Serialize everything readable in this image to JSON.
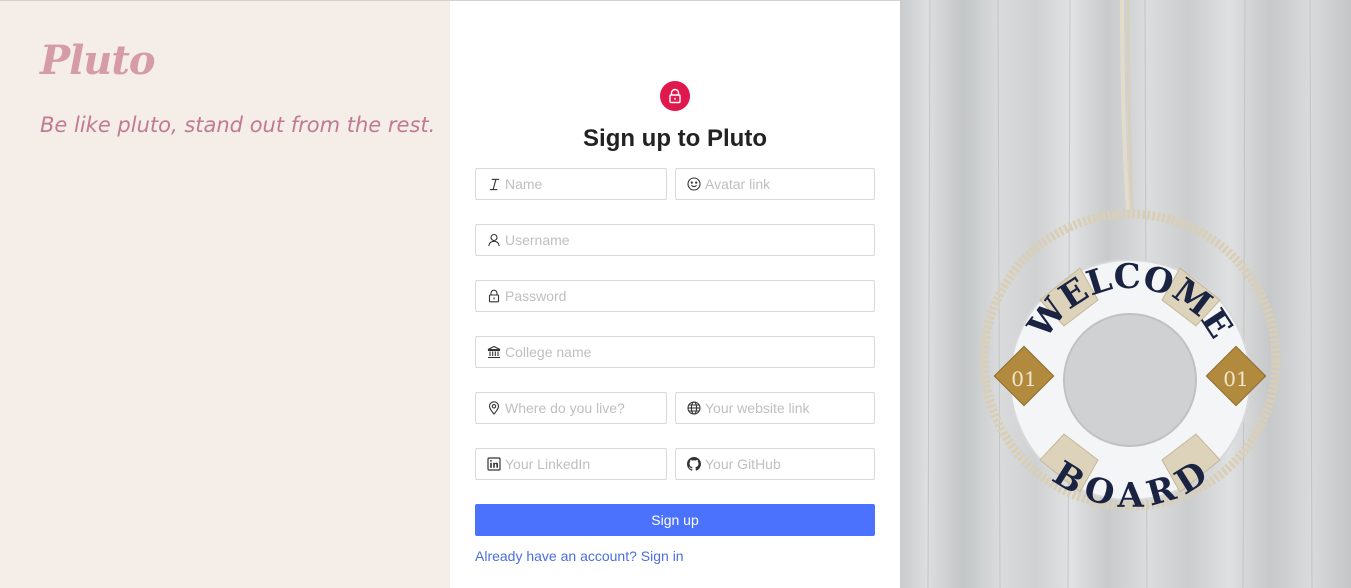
{
  "brand": {
    "name": "Pluto",
    "tagline": "Be like pluto, stand out from the rest."
  },
  "form": {
    "title": "Sign up to Pluto",
    "fields": {
      "name": {
        "placeholder": "Name",
        "icon": "text-cursor-icon"
      },
      "avatar": {
        "placeholder": "Avatar link",
        "icon": "smile-icon"
      },
      "username": {
        "placeholder": "Username",
        "icon": "user-icon"
      },
      "password": {
        "placeholder": "Password",
        "icon": "lock-icon"
      },
      "college": {
        "placeholder": "College name",
        "icon": "bank-icon"
      },
      "location": {
        "placeholder": "Where do you live?",
        "icon": "location-pin-icon"
      },
      "website": {
        "placeholder": "Your website link",
        "icon": "globe-icon"
      },
      "linkedin": {
        "placeholder": "Your LinkedIn",
        "icon": "linkedin-icon"
      },
      "github": {
        "placeholder": "Your GitHub",
        "icon": "github-icon"
      }
    },
    "submit_label": "Sign up",
    "signin_text": "Already have an account? Sign in"
  },
  "image": {
    "top_text": "WELCOME",
    "bottom_text": "BOARD",
    "left_tag": "01",
    "right_tag": "01"
  },
  "colors": {
    "brand_accent": "#d69ba8",
    "lock_badge": "#e0184d",
    "primary_button": "#4a72fd",
    "link": "#4a6ee0",
    "left_panel_bg": "#f5ede8"
  }
}
